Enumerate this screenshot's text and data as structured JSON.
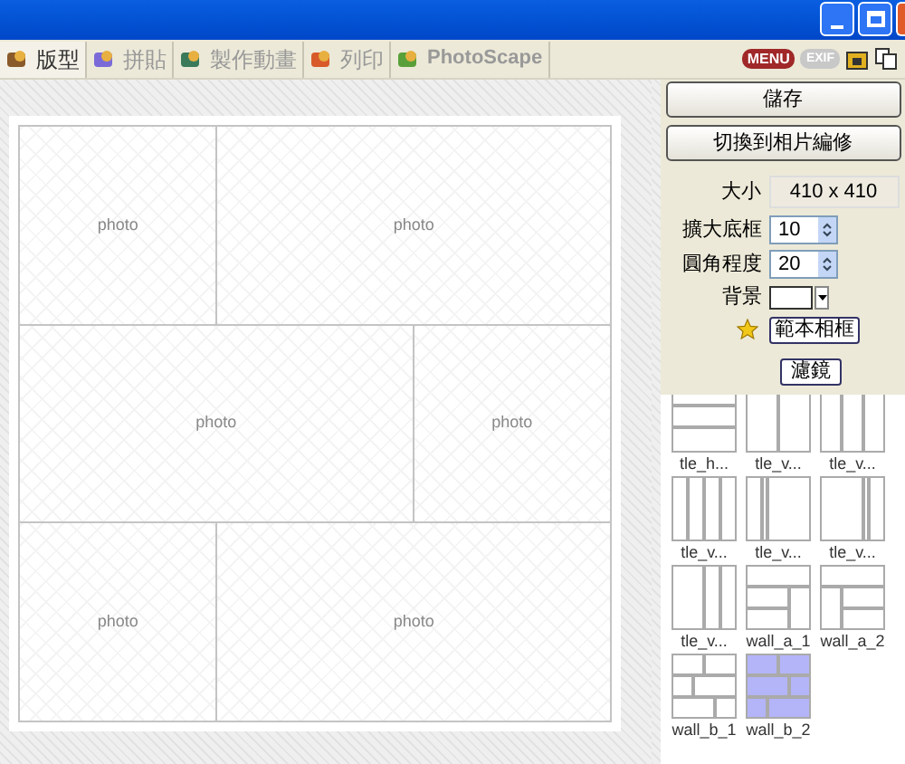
{
  "tabs": [
    {
      "label": "版型",
      "selected": true
    },
    {
      "label": "拼貼",
      "selected": false
    },
    {
      "label": "製作動畫",
      "selected": false
    },
    {
      "label": "列印",
      "selected": false
    },
    {
      "label": "PhotoScape",
      "selected": false
    }
  ],
  "toolbar": {
    "menu_badge": "MENU",
    "exif_badge": "EXIF"
  },
  "collage": {
    "rows": [
      {
        "cells": [
          {
            "label": "photo"
          },
          {
            "label": "photo"
          }
        ]
      },
      {
        "cells": [
          {
            "label": "photo"
          },
          {
            "label": "photo"
          }
        ]
      },
      {
        "cells": [
          {
            "label": "photo"
          },
          {
            "label": "photo"
          }
        ]
      }
    ]
  },
  "panel": {
    "save_button": "儲存",
    "switch_button": "切換到相片編修",
    "size": {
      "label": "大小",
      "value": "410 x 410"
    },
    "border": {
      "label": "擴大底框",
      "value": "10"
    },
    "rounding": {
      "label": "圓角程度",
      "value": "20"
    },
    "background": {
      "label": "背景"
    },
    "template_button": "範本相框",
    "filter_button": "濾鏡"
  },
  "templates": [
    {
      "label": "tle_h...",
      "selected": false
    },
    {
      "label": "tle_v...",
      "selected": false
    },
    {
      "label": "tle_v...",
      "selected": false
    },
    {
      "label": "tle_v...",
      "selected": false
    },
    {
      "label": "tle_v...",
      "selected": false
    },
    {
      "label": "tle_v...",
      "selected": false
    },
    {
      "label": "tle_v...",
      "selected": false
    },
    {
      "label": "wall_a_1",
      "selected": false
    },
    {
      "label": "wall_a_2",
      "selected": false
    },
    {
      "label": "wall_b_1",
      "selected": false
    },
    {
      "label": "wall_b_2",
      "selected": true
    }
  ]
}
